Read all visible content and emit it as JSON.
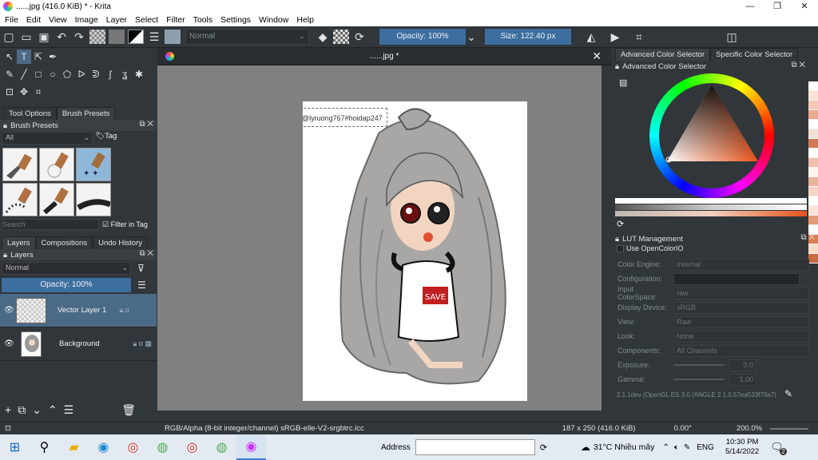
{
  "window": {
    "title": "......jpg (416.0 KiB)  * - Krita",
    "minimize": "—",
    "maximize": "❐",
    "close": "✕"
  },
  "menu": [
    "File",
    "Edit",
    "View",
    "Image",
    "Layer",
    "Select",
    "Filter",
    "Tools",
    "Settings",
    "Window",
    "Help"
  ],
  "toolbar": {
    "blend_mode": "Normal",
    "opacity": "Opacity: 100%",
    "size": "Size: 122.40 px"
  },
  "left_panel": {
    "tabs": [
      "Tool Options",
      "Brush Presets"
    ],
    "brush_presets_title": "Brush Presets",
    "filter_all": "All",
    "tag_label": "Tag",
    "search_placeholder": "Search",
    "filter_in_tag": "Filter in Tag",
    "layer_tabs": [
      "Layers",
      "Compositions",
      "Undo History"
    ],
    "layers_title": "Layers",
    "layer_blend": "Normal",
    "layer_opacity": "Opacity:  100%",
    "layers": [
      {
        "name": "Vector Layer 1",
        "selected": true
      },
      {
        "name": "Background",
        "selected": false
      }
    ]
  },
  "document": {
    "tab_title": "......jpg *",
    "text_annotation": "@lyruong767#hoidap247"
  },
  "right_panel": {
    "tabs": [
      "Advanced Color Selector",
      "Specific Color Selector"
    ],
    "color_selector_title": "Advanced Color Selector",
    "lut_title": "LUT Management",
    "use_ocio": "Use OpenColorIO",
    "rows": [
      {
        "label": "Color Engine:",
        "value": "Internal"
      },
      {
        "label": "Configuration:",
        "value": ""
      },
      {
        "label": "Input ColorSpace:",
        "value": "raw"
      },
      {
        "label": "Display Device:",
        "value": "sRGB"
      },
      {
        "label": "View:",
        "value": "Raw"
      },
      {
        "label": "Look:",
        "value": "None"
      },
      {
        "label": "Components:",
        "value": "All Channels"
      },
      {
        "label": "Exposure:",
        "value": "0.0"
      },
      {
        "label": "Gamma:",
        "value": "1.00"
      }
    ],
    "version": "2.1.1dev (OpenGL ES 3.0 (ANGLE 2.1.0.57ea533f79a7))",
    "swatch_colors": [
      "#ffffff",
      "#fbe2d6",
      "#f5c9b3",
      "#e8a98d",
      "#ffffff",
      "#f3e0d4",
      "#d07a55",
      "#ffffff",
      "#f0c0a8",
      "#fff4ea",
      "#e8b39a",
      "#f8d4c2",
      "#ffffff",
      "#fbe3d5",
      "#e29b78",
      "#ffffff",
      "#d9804f",
      "#f7dcc9",
      "#c86b43"
    ]
  },
  "status": {
    "colorspace": "RGB/Alpha (8-bit integer/channel)  sRGB-elle-V2-srgbtrc.icc",
    "dimensions": "187 x 250 (416.0 KiB)",
    "rotation": "0.00°",
    "zoom": "200.0%"
  },
  "taskbar": {
    "address_label": "Address",
    "weather": "31°C  Nhiều mây",
    "lang": "ENG",
    "time": "10:30 PM",
    "date": "5/14/2022",
    "notif": "2"
  }
}
